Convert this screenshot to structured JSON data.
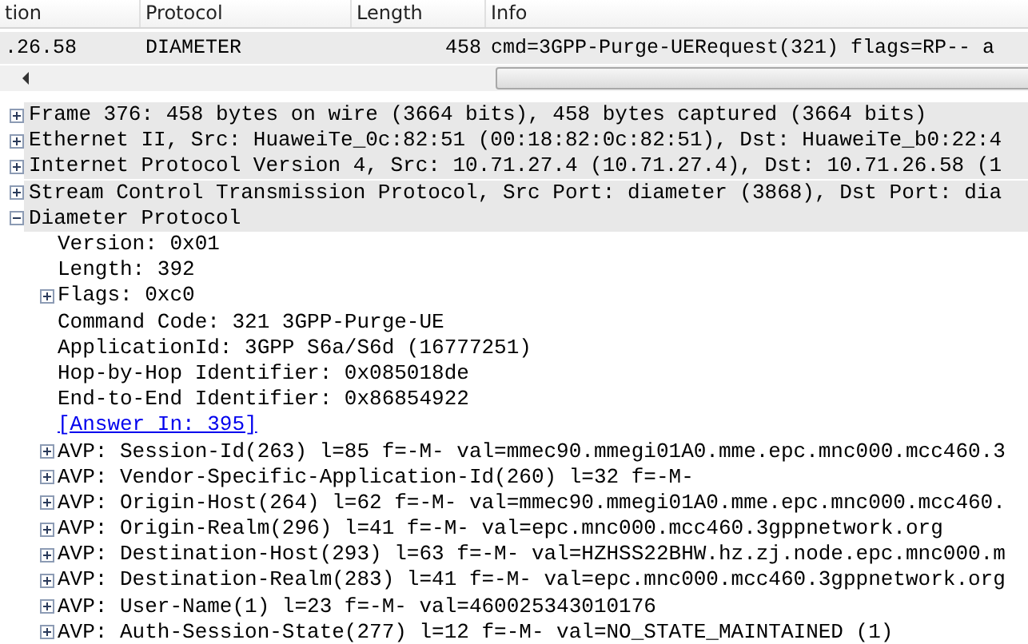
{
  "packet_list": {
    "columns": [
      {
        "label": "tion"
      },
      {
        "label": "Protocol"
      },
      {
        "label": "Length"
      },
      {
        "label": "Info"
      }
    ],
    "rows": [
      {
        "selected": false,
        "cells": [
          ".26.58",
          "DIAMETER",
          "458",
          "cmd=3GPP-Purge-UERequest(321) flags=RP-- a"
        ]
      }
    ]
  },
  "details": [
    {
      "text": "Frame 376: 458 bytes on wire (3664 bits), 458 bytes captured (3664 bits)",
      "expanded": false
    },
    {
      "text": "Ethernet II, Src: HuaweiTe_0c:82:51 (00:18:82:0c:82:51), Dst: HuaweiTe_b0:22:4",
      "expanded": false
    },
    {
      "text": "Internet Protocol Version 4, Src: 10.71.27.4 (10.71.27.4), Dst: 10.71.26.58 (1",
      "expanded": false
    },
    {
      "text": "Stream Control Transmission Protocol, Src Port: diameter (3868), Dst Port: dia",
      "expanded": false
    },
    {
      "text": "Diameter Protocol",
      "expanded": true,
      "children": [
        {
          "text": "Version: 0x01",
          "kind": "field"
        },
        {
          "text": "Length: 392",
          "kind": "field"
        },
        {
          "text": "Flags: 0xc0",
          "kind": "field",
          "expanded": false
        },
        {
          "text": "Command Code: 321 3GPP-Purge-UE",
          "kind": "field"
        },
        {
          "text": "ApplicationId: 3GPP S6a/S6d (16777251)",
          "kind": "field"
        },
        {
          "text": "Hop-by-Hop Identifier: 0x085018de",
          "kind": "field"
        },
        {
          "text": "End-to-End Identifier: 0x86854922",
          "kind": "field"
        },
        {
          "text": "[Answer In: 395]",
          "kind": "link"
        },
        {
          "text": "AVP: Session-Id(263) l=85 f=-M- val=mmec90.mmegi01A0.mme.epc.mnc000.mcc460.3",
          "kind": "field",
          "expanded": false
        },
        {
          "text": "AVP: Vendor-Specific-Application-Id(260) l=32 f=-M-",
          "kind": "field",
          "expanded": false
        },
        {
          "text": "AVP: Origin-Host(264) l=62 f=-M- val=mmec90.mmegi01A0.mme.epc.mnc000.mcc460.",
          "kind": "field",
          "expanded": false
        },
        {
          "text": "AVP: Origin-Realm(296) l=41 f=-M- val=epc.mnc000.mcc460.3gppnetwork.org",
          "kind": "field",
          "expanded": false
        },
        {
          "text": "AVP: Destination-Host(293) l=63 f=-M- val=HZHSS22BHW.hz.zj.node.epc.mnc000.m",
          "kind": "field",
          "expanded": false
        },
        {
          "text": "AVP: Destination-Realm(283) l=41 f=-M- val=epc.mnc000.mcc460.3gppnetwork.org",
          "kind": "field",
          "expanded": false
        },
        {
          "text": "AVP: User-Name(1) l=23 f=-M- val=460025343010176",
          "kind": "field",
          "expanded": false
        },
        {
          "text": "AVP: Auth-Session-State(277) l=12 f=-M- val=NO_STATE_MAINTAINED (1)",
          "kind": "field",
          "expanded": false
        }
      ]
    }
  ]
}
